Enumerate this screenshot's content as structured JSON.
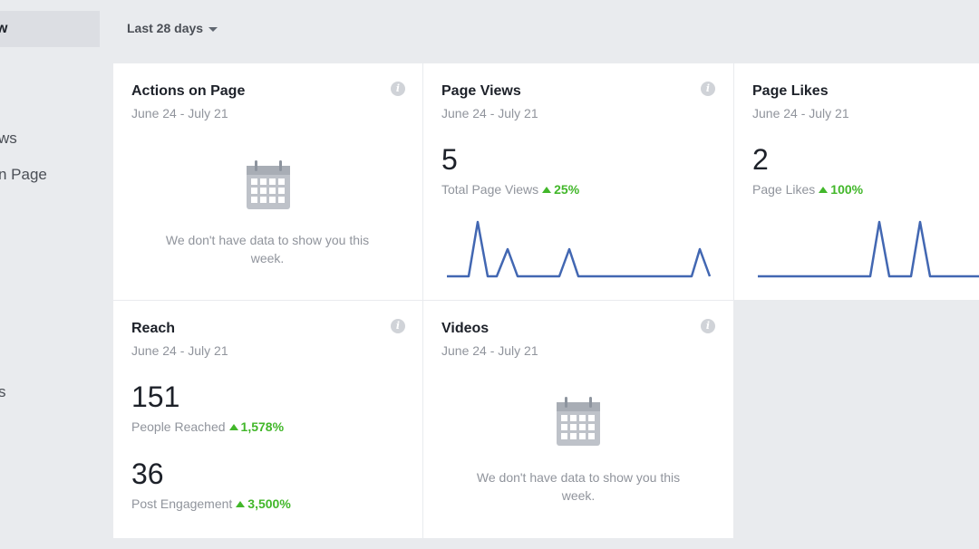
{
  "sidebar": {
    "active_item": "w",
    "items": [
      "ws",
      "n Page",
      "s"
    ]
  },
  "filter": {
    "date_range": "Last 28 days"
  },
  "cards": {
    "actions": {
      "title": "Actions on Page",
      "date_range": "June 24 - July 21",
      "no_data": "We don't have data to show you this week.",
      "icon": "calendar-icon"
    },
    "page_views": {
      "title": "Page Views",
      "date_range": "June 24 - July 21",
      "value": "5",
      "label": "Total Page Views",
      "trend": "25%",
      "trend_direction": "up"
    },
    "page_likes": {
      "title": "Page Likes",
      "date_range": "June 24 - July 21",
      "value": "2",
      "label": "Page Likes",
      "trend": "100%",
      "trend_direction": "up"
    },
    "reach": {
      "title": "Reach",
      "date_range": "June 24 - July 21",
      "value1": "151",
      "label1": "People Reached",
      "trend1": "1,578%",
      "value2": "36",
      "label2": "Post Engagement",
      "trend2": "3,500%"
    },
    "videos": {
      "title": "Videos",
      "date_range": "June 24 - July 21",
      "no_data": "We don't have data to show you this week.",
      "icon": "calendar-icon"
    }
  },
  "colors": {
    "background": "#e9ebee",
    "card": "#ffffff",
    "sparkline": "#4267b2",
    "trend_up": "#42b72a",
    "muted_text": "#90949c"
  }
}
